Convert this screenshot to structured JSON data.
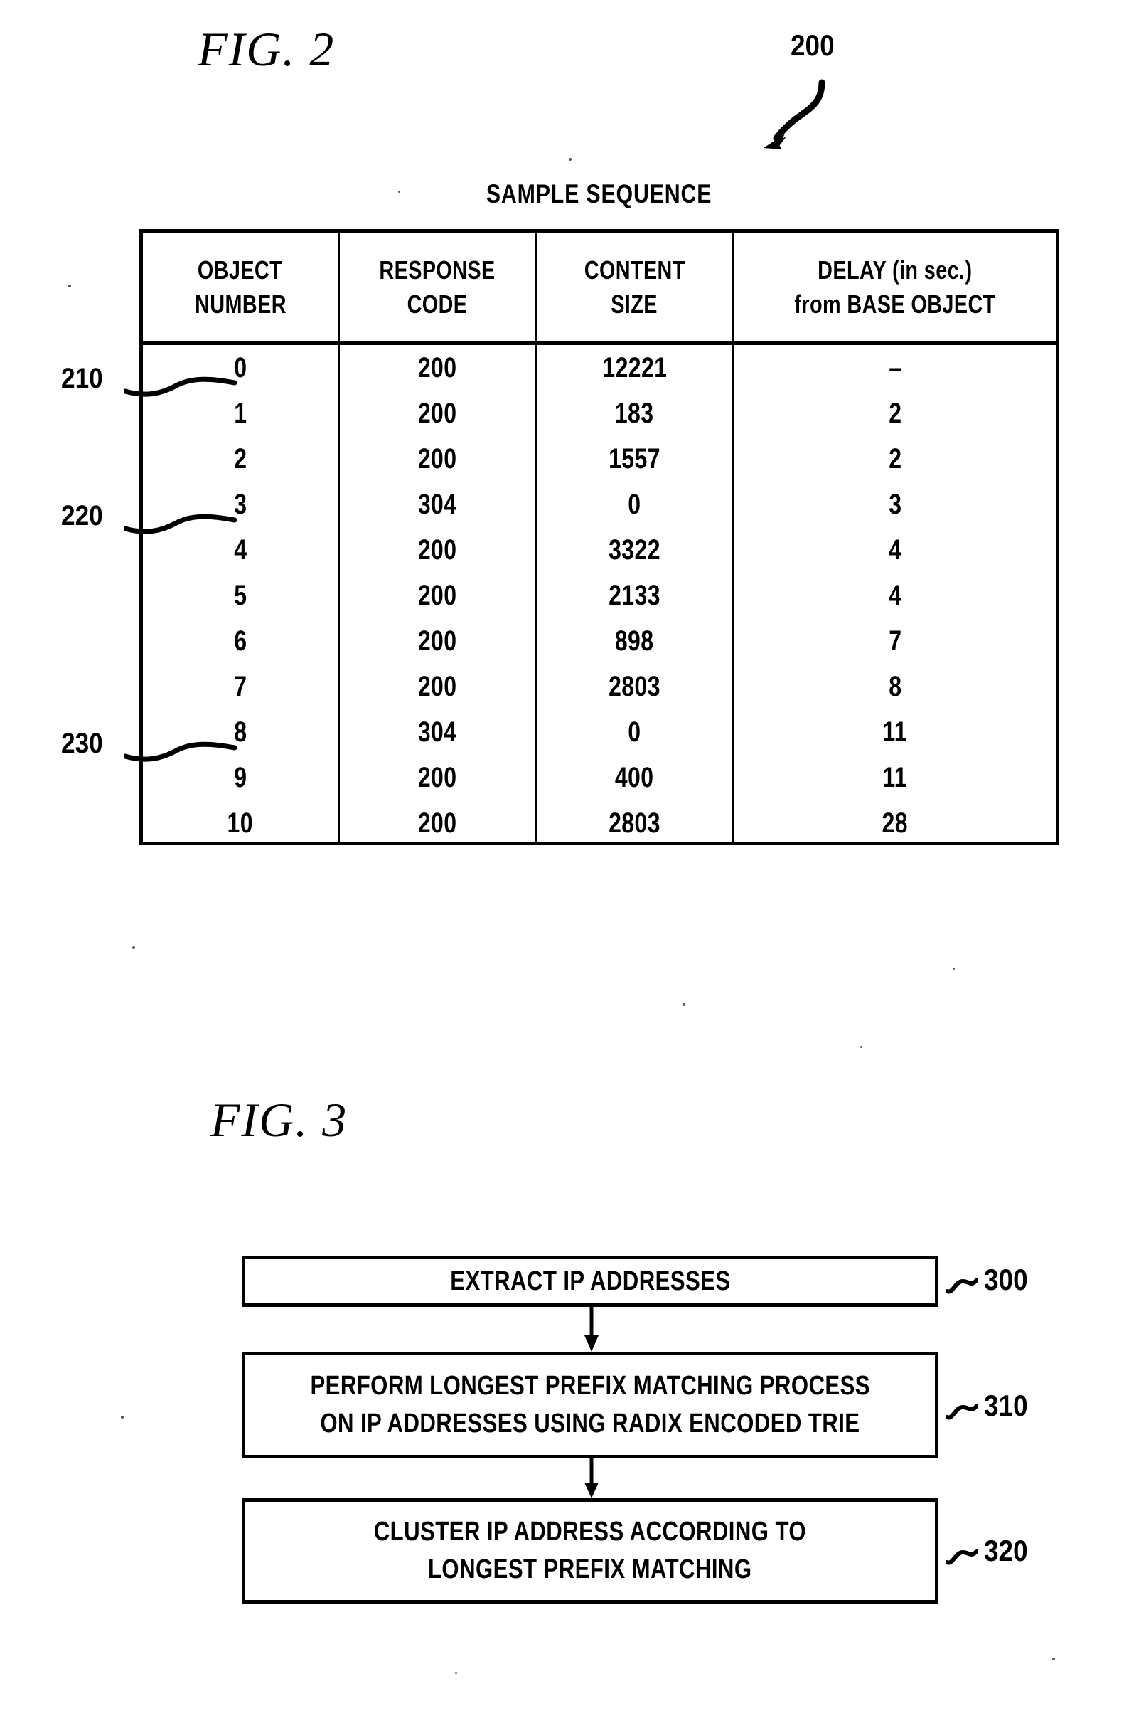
{
  "figures": {
    "fig2": {
      "title": "FIG. 2",
      "reference": "200",
      "table": {
        "caption": "SAMPLE SEQUENCE",
        "columns": [
          {
            "line1": "OBJECT",
            "line2": "NUMBER"
          },
          {
            "line1": "RESPONSE",
            "line2": "CODE"
          },
          {
            "line1": "CONTENT",
            "line2": "SIZE"
          },
          {
            "line1": "DELAY (in sec.)",
            "line2": "from BASE OBJECT"
          }
        ],
        "rows": [
          {
            "object_number": "0",
            "response_code": "200",
            "content_size": "12221",
            "delay": "–"
          },
          {
            "object_number": "1",
            "response_code": "200",
            "content_size": "183",
            "delay": "2"
          },
          {
            "object_number": "2",
            "response_code": "200",
            "content_size": "1557",
            "delay": "2"
          },
          {
            "object_number": "3",
            "response_code": "304",
            "content_size": "0",
            "delay": "3"
          },
          {
            "object_number": "4",
            "response_code": "200",
            "content_size": "3322",
            "delay": "4"
          },
          {
            "object_number": "5",
            "response_code": "200",
            "content_size": "2133",
            "delay": "4"
          },
          {
            "object_number": "6",
            "response_code": "200",
            "content_size": "898",
            "delay": "7"
          },
          {
            "object_number": "7",
            "response_code": "200",
            "content_size": "2803",
            "delay": "8"
          },
          {
            "object_number": "8",
            "response_code": "304",
            "content_size": "0",
            "delay": "11"
          },
          {
            "object_number": "9",
            "response_code": "200",
            "content_size": "400",
            "delay": "11"
          },
          {
            "object_number": "10",
            "response_code": "200",
            "content_size": "2803",
            "delay": "28"
          }
        ]
      },
      "callouts": [
        {
          "label": "210",
          "points_to_row": "0"
        },
        {
          "label": "220",
          "points_to_row": "3"
        },
        {
          "label": "230",
          "points_to_row": "8"
        }
      ]
    },
    "fig3": {
      "title": "FIG. 3",
      "steps": [
        {
          "reference": "300",
          "lines": [
            "EXTRACT IP ADDRESSES"
          ]
        },
        {
          "reference": "310",
          "lines": [
            "PERFORM LONGEST PREFIX MATCHING PROCESS",
            "ON IP ADDRESSES USING RADIX ENCODED TRIE"
          ]
        },
        {
          "reference": "320",
          "lines": [
            "CLUSTER IP ADDRESS ACCORDING TO",
            "LONGEST PREFIX MATCHING"
          ]
        }
      ]
    }
  },
  "colors": {
    "ink": "#000000",
    "paper": "#ffffff"
  }
}
